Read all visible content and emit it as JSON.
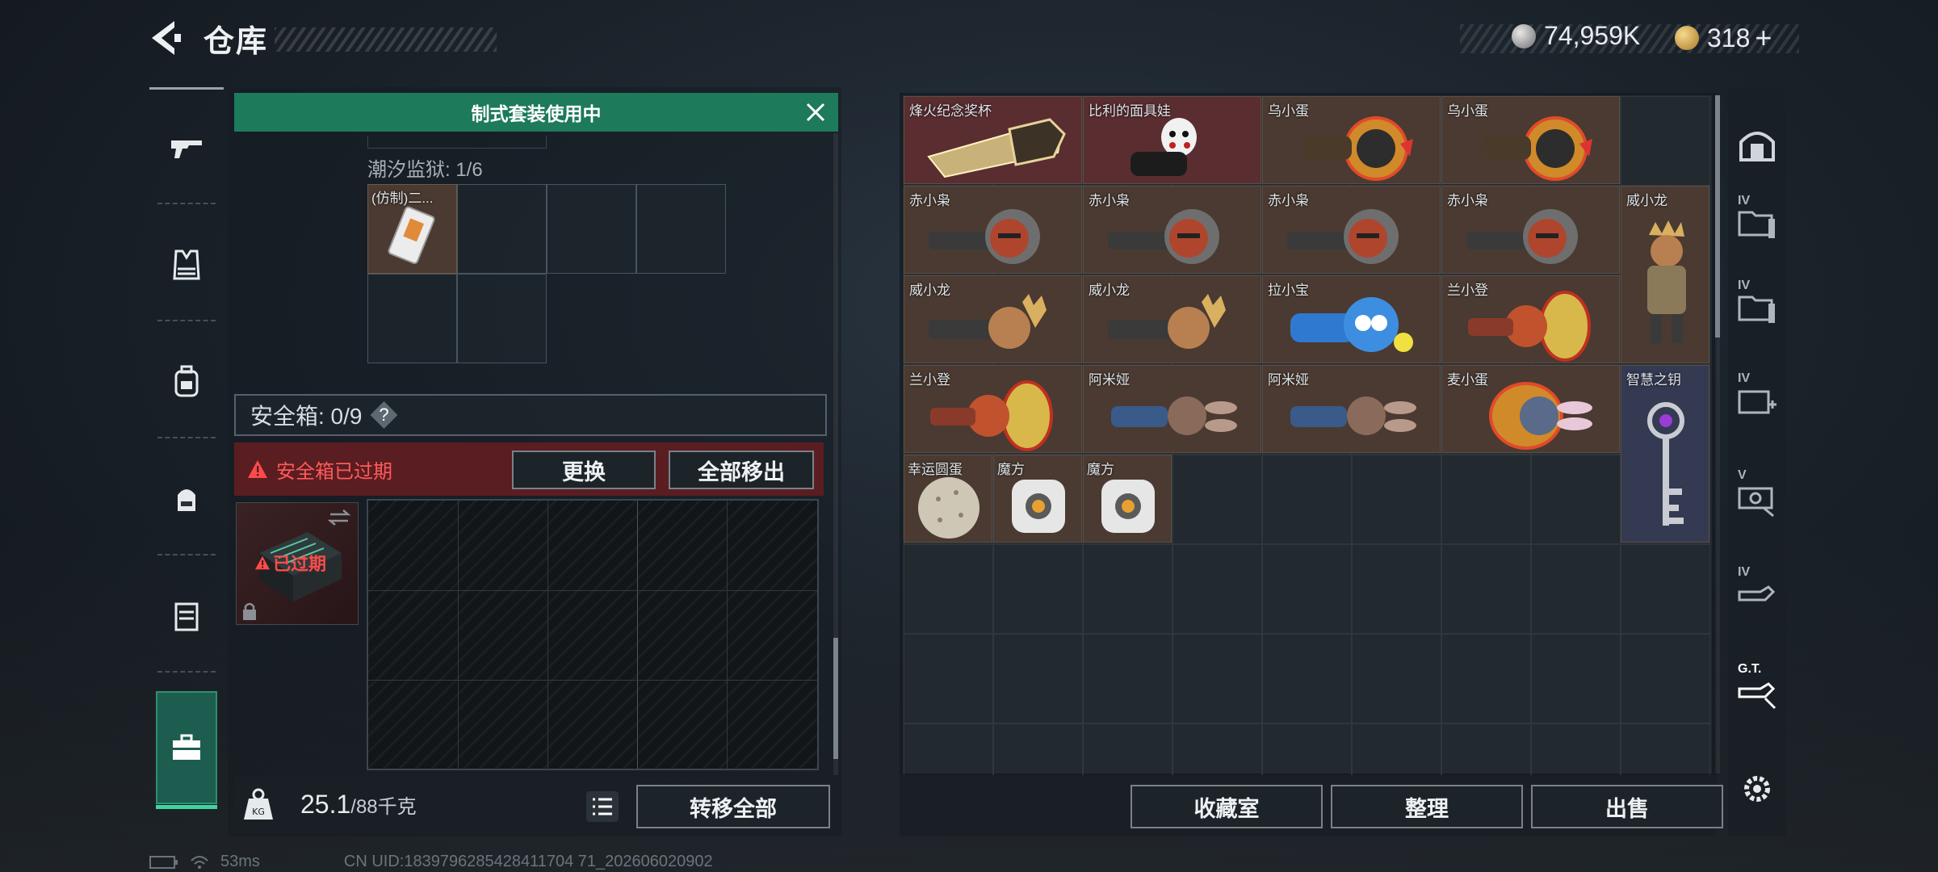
{
  "header": {
    "title": "仓库"
  },
  "currency": {
    "silver": "74,959K",
    "gold": "318"
  },
  "left": {
    "banner": "制式套装使用中",
    "tide_label": "潮汐监狱: 1/6",
    "tide_item": "(仿制)二...",
    "safebox_label": "安全箱: 0/9",
    "safebox_help": "?",
    "expired_text": "安全箱已过期",
    "replace_btn": "更换",
    "remove_all_btn": "全部移出",
    "thumb_expired": "已过期",
    "weight_value": "25.1",
    "weight_max": "/88千克",
    "transfer_all_btn": "转移全部"
  },
  "right": {
    "items": [
      {
        "name": "烽火纪念奖杯"
      },
      {
        "name": "比利的面具娃"
      },
      {
        "name": "乌小蛋"
      },
      {
        "name": "乌小蛋"
      },
      {
        "name": "赤小枭"
      },
      {
        "name": "赤小枭"
      },
      {
        "name": "赤小枭"
      },
      {
        "name": "赤小枭"
      },
      {
        "name": "威小龙"
      },
      {
        "name": "威小龙"
      },
      {
        "name": "威小龙"
      },
      {
        "name": "拉小宝"
      },
      {
        "name": "兰小登"
      },
      {
        "name": "兰小登"
      },
      {
        "name": "阿米娅"
      },
      {
        "name": "阿米娅"
      },
      {
        "name": "麦小蛋"
      },
      {
        "name": "智慧之钥"
      },
      {
        "name": "幸运圆蛋"
      },
      {
        "name": "魔方"
      },
      {
        "name": "魔方"
      }
    ],
    "collection_btn": "收藏室",
    "sort_btn": "整理",
    "sell_btn": "出售"
  },
  "side_tabs": [
    {
      "tag": ""
    },
    {
      "tag": "IV"
    },
    {
      "tag": "IV"
    },
    {
      "tag": "IV"
    },
    {
      "tag": "V"
    },
    {
      "tag": "IV"
    },
    {
      "tag": "G.T."
    }
  ],
  "status": {
    "ping": "53ms",
    "uid": "CN UID:1839796285428411704 71_202606020902"
  }
}
